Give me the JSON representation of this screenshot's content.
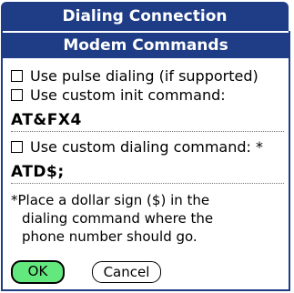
{
  "window": {
    "title": "Dialing Connection"
  },
  "section": {
    "title": "Modem Commands"
  },
  "options": {
    "pulse_dialing": {
      "label": "Use pulse dialing (if supported)",
      "checked": false
    },
    "custom_init": {
      "label": "Use custom init command:",
      "checked": false,
      "value": "AT&FX4"
    },
    "custom_dial": {
      "label": "Use custom dialing command: *",
      "checked": false,
      "value": "ATD$;"
    }
  },
  "note": {
    "line1": "*Place a dollar sign ($) in the",
    "line2": "dialing command where the",
    "line3": "phone number should go."
  },
  "buttons": {
    "ok": "OK",
    "cancel": "Cancel"
  },
  "colors": {
    "header": "#1f3d86",
    "ok_button": "#63e87e"
  }
}
